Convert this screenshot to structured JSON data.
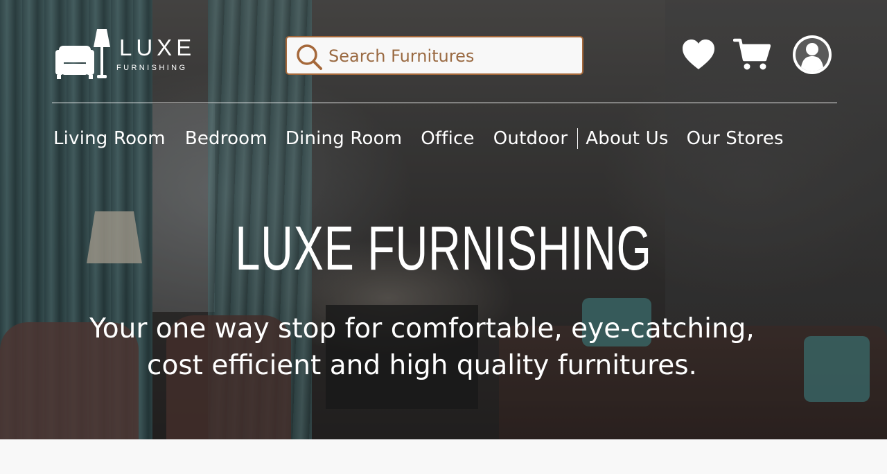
{
  "brand": {
    "name": "LUXE",
    "tagline": "FURNISHING",
    "accent_color": "#a5683a"
  },
  "header": {
    "search": {
      "placeholder": "Search Furnitures",
      "value": "",
      "icon": "search-icon"
    },
    "actions": [
      {
        "name": "wishlist",
        "icon": "heart-icon"
      },
      {
        "name": "cart",
        "icon": "cart-icon"
      },
      {
        "name": "account",
        "icon": "user-avatar-icon"
      }
    ]
  },
  "nav": {
    "categories": [
      "Living Room",
      "Bedroom",
      "Dining Room",
      "Office",
      "Outdoor"
    ],
    "links": [
      "About Us",
      "Our Stores"
    ]
  },
  "hero": {
    "title": "LUXE FURNISHING",
    "subtitle_line1": "Your one way stop for comfortable, eye-catching,",
    "subtitle_line2": "cost efficient and high quality furnitures."
  }
}
